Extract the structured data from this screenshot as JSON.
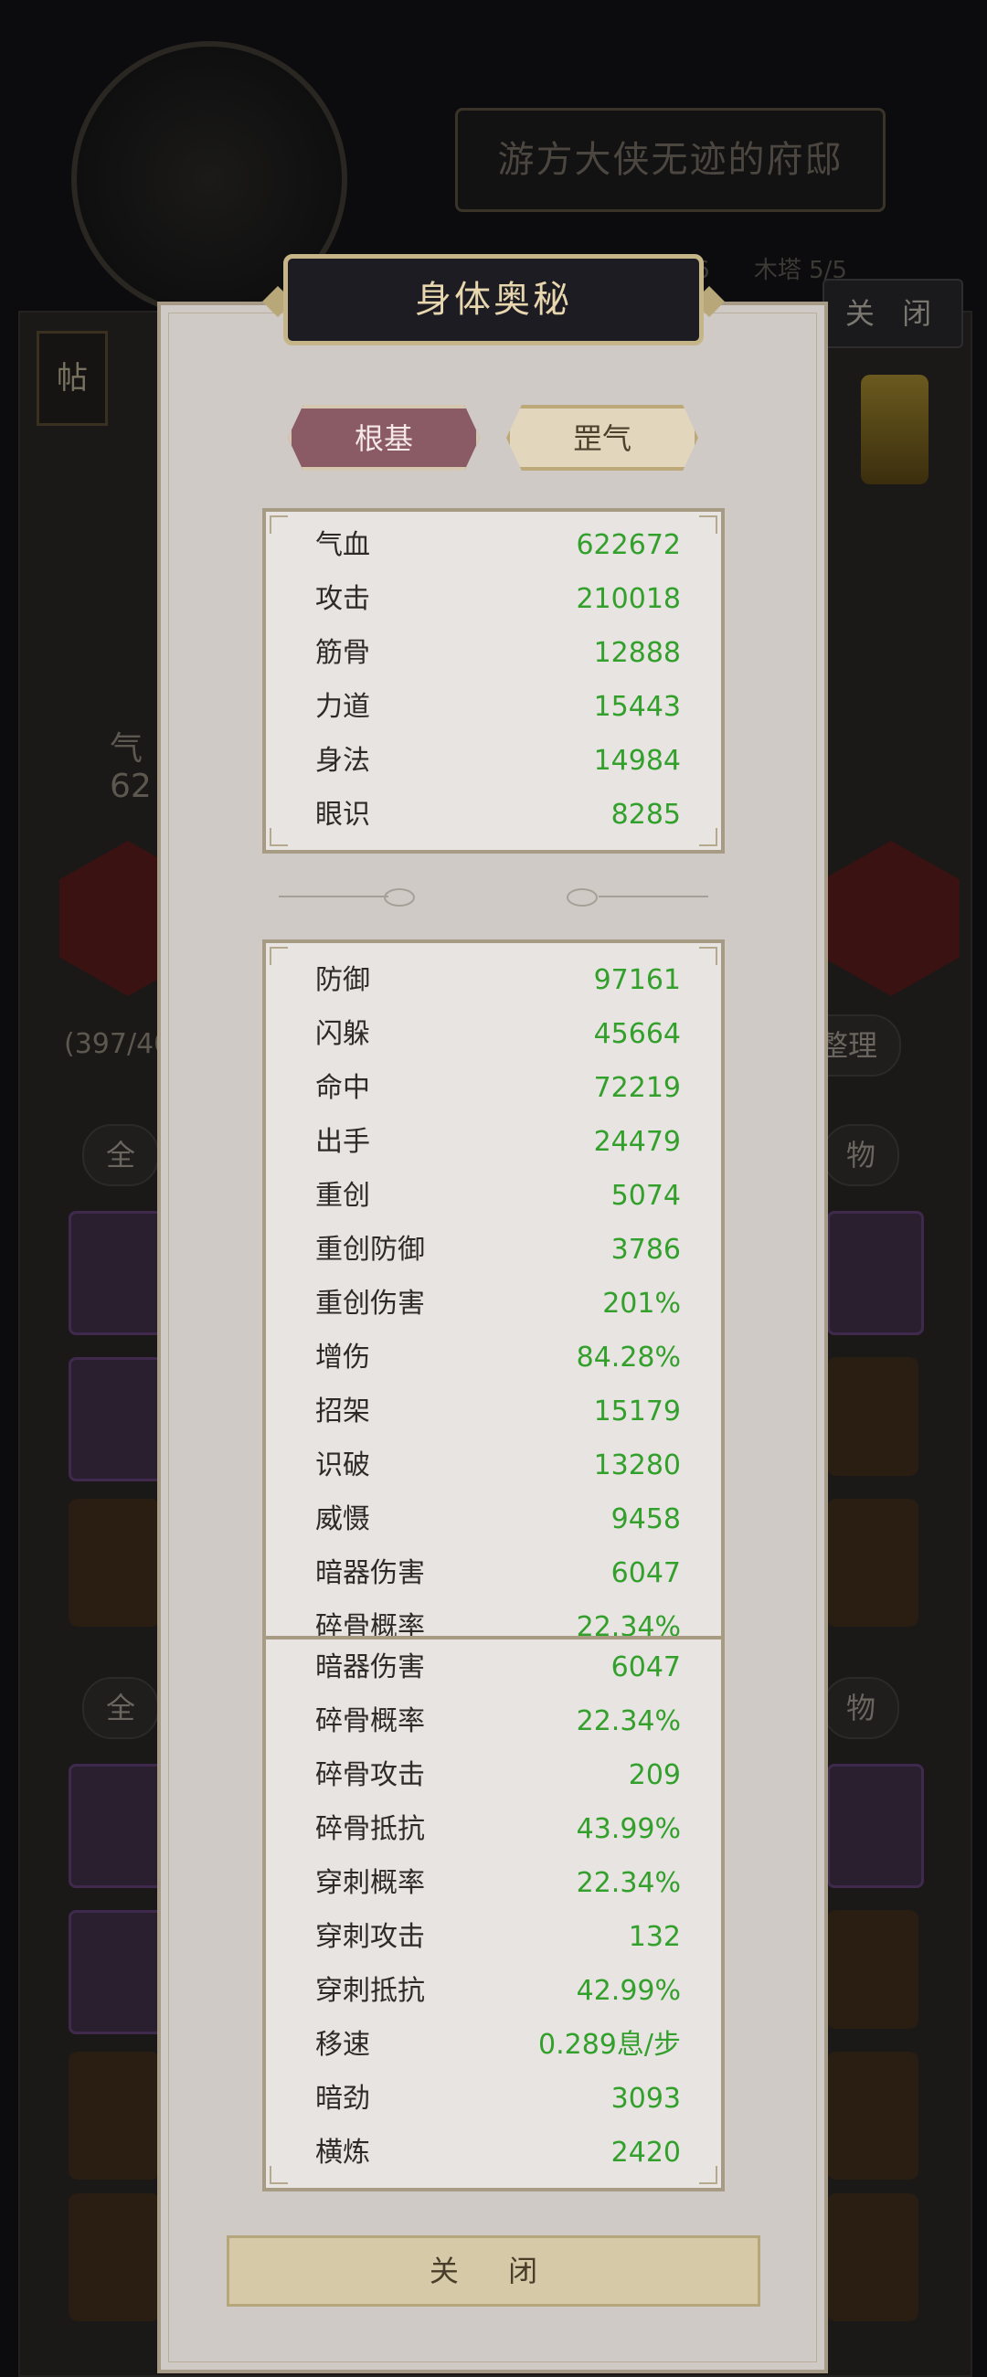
{
  "background": {
    "residence_title": "游方大侠无迹的府邸",
    "level_info": "6",
    "level_info_2": "木塔  5/5",
    "close_label": "关 闭",
    "tag_label": "帖",
    "inventory_count": "(397/40",
    "sort_label": "整理",
    "filter_all_1": "全",
    "filter_item_1": "物",
    "filter_all_2": "全",
    "filter_item_2": "物",
    "left_text_1": "气",
    "left_text_2": "62"
  },
  "modal": {
    "title": "身体奥秘",
    "tabs": [
      {
        "label": "根基",
        "active": true
      },
      {
        "label": "罡气",
        "active": false
      }
    ],
    "basic_stats": [
      {
        "label": "气血",
        "value": "622672"
      },
      {
        "label": "攻击",
        "value": "210018"
      },
      {
        "label": "筋骨",
        "value": "12888"
      },
      {
        "label": "力道",
        "value": "15443"
      },
      {
        "label": "身法",
        "value": "14984"
      },
      {
        "label": "眼识",
        "value": "8285"
      }
    ],
    "combat_stats": [
      {
        "label": "防御",
        "value": "97161"
      },
      {
        "label": "闪躲",
        "value": "45664"
      },
      {
        "label": "命中",
        "value": "72219"
      },
      {
        "label": "出手",
        "value": "24479"
      },
      {
        "label": "重创",
        "value": "5074"
      },
      {
        "label": "重创防御",
        "value": "3786"
      },
      {
        "label": "重创伤害",
        "value": "201%"
      },
      {
        "label": "增伤",
        "value": "84.28%"
      },
      {
        "label": "招架",
        "value": "15179"
      },
      {
        "label": "识破",
        "value": "13280"
      },
      {
        "label": "威慑",
        "value": "9458"
      },
      {
        "label": "暗器伤害",
        "value": "6047"
      },
      {
        "label": "碎骨概率",
        "value": "22.34%"
      }
    ],
    "extra_stats": [
      {
        "label": "暗器伤害",
        "value": "6047"
      },
      {
        "label": "碎骨概率",
        "value": "22.34%"
      },
      {
        "label": "碎骨攻击",
        "value": "209"
      },
      {
        "label": "碎骨抵抗",
        "value": "43.99%"
      },
      {
        "label": "穿刺概率",
        "value": "22.34%"
      },
      {
        "label": "穿刺攻击",
        "value": "132"
      },
      {
        "label": "穿刺抵抗",
        "value": "42.99%"
      },
      {
        "label": "移速",
        "value": "0.289息/步"
      },
      {
        "label": "暗劲",
        "value": "3093"
      },
      {
        "label": "横炼",
        "value": "2420"
      }
    ],
    "close_label": "关 闭"
  },
  "colors": {
    "value_green": "#33a02c",
    "active_tab": "#8a5a65",
    "modal_bg": "#cfcac5"
  }
}
